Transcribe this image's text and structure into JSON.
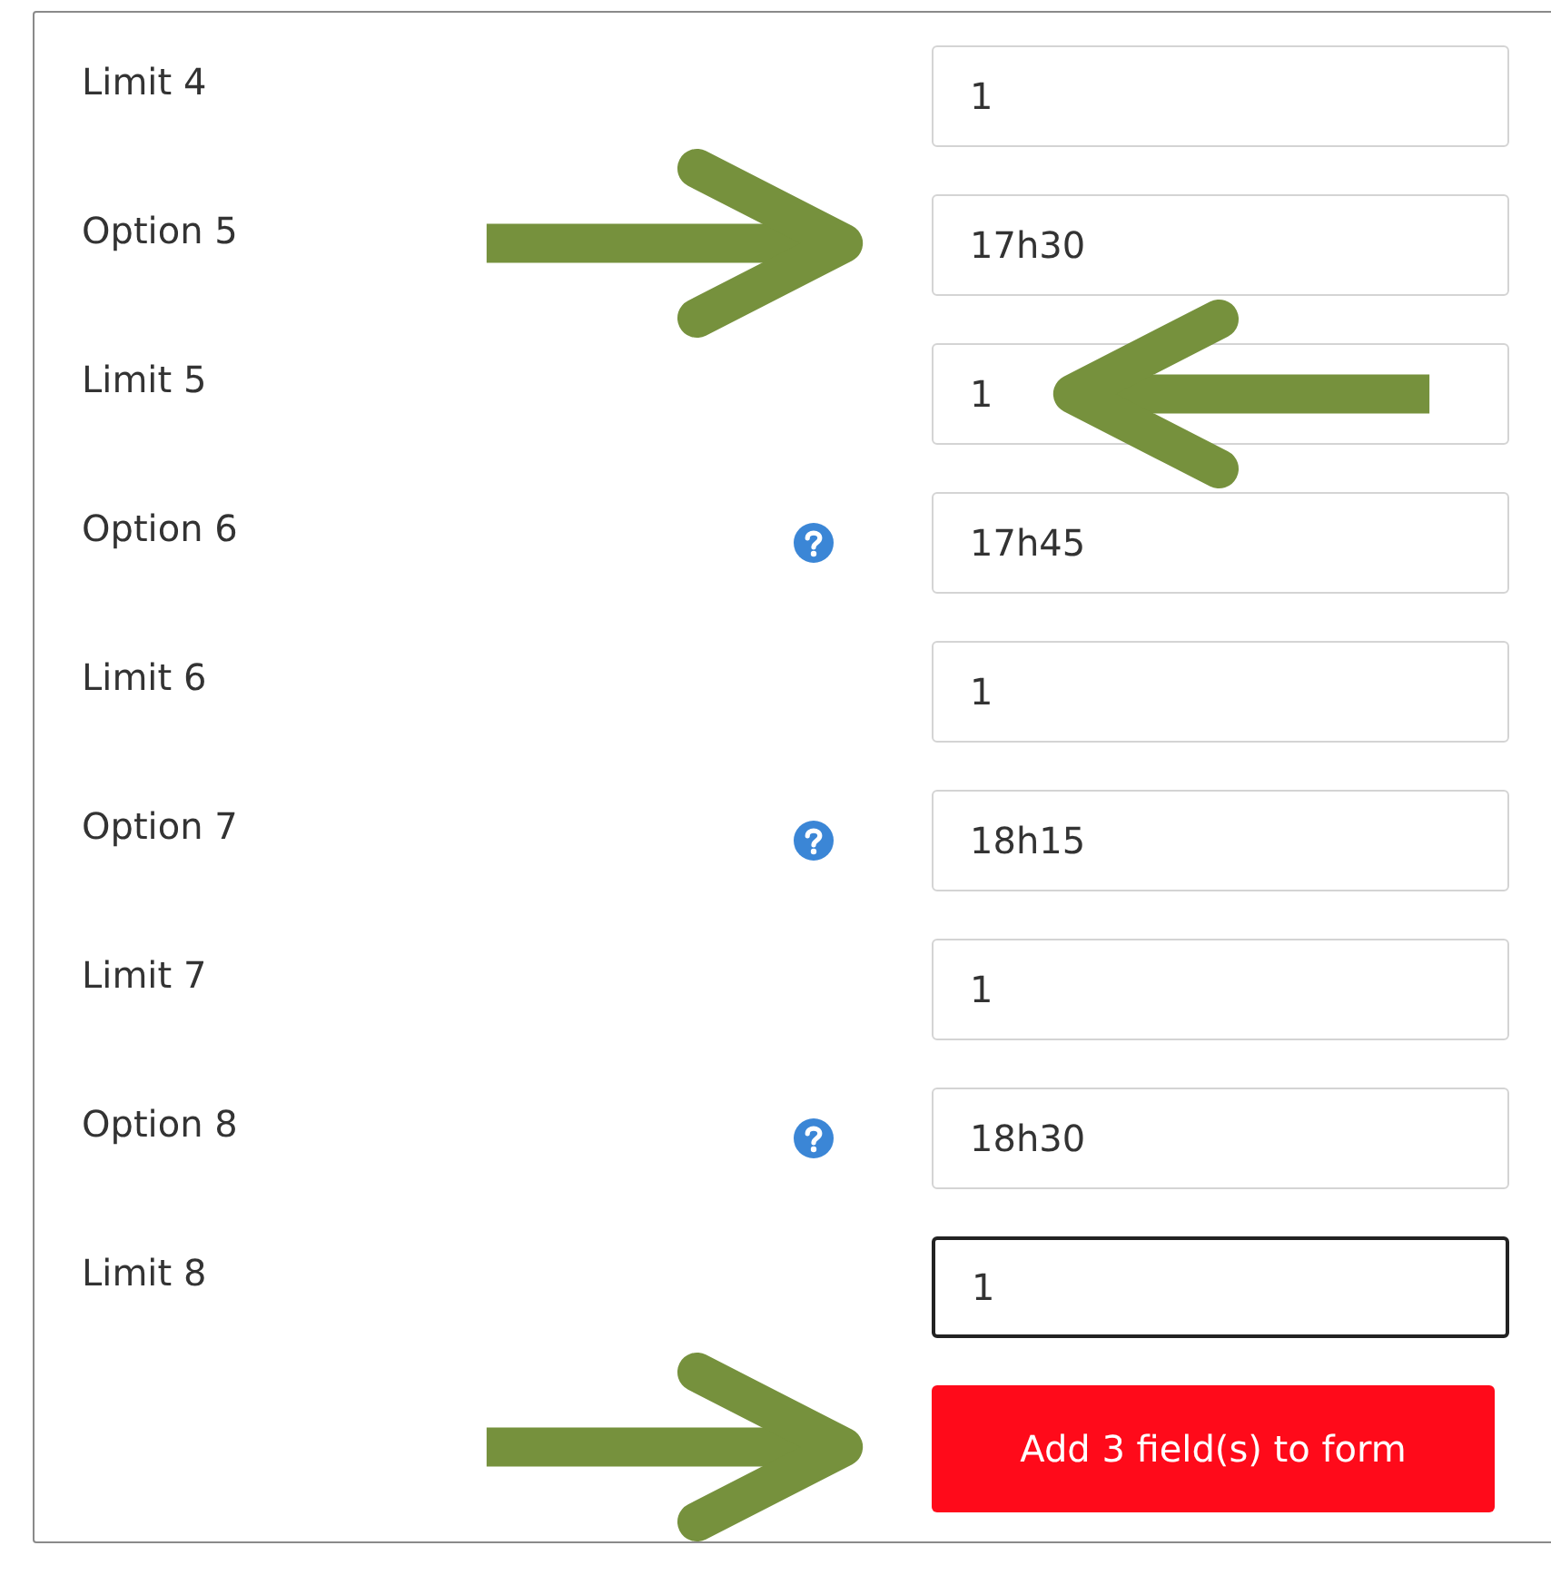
{
  "rows": [
    {
      "label": "Limit 4",
      "value": "1",
      "help": false,
      "focused": false
    },
    {
      "label": "Option 5",
      "value": "17h30",
      "help": false,
      "focused": false,
      "arrow_before": true
    },
    {
      "label": "Limit 5",
      "value": "1",
      "help": false,
      "focused": false,
      "arrow_inside": true
    },
    {
      "label": "Option 6",
      "value": "17h45",
      "help": true,
      "focused": false
    },
    {
      "label": "Limit 6",
      "value": "1",
      "help": false,
      "focused": false
    },
    {
      "label": "Option 7",
      "value": "18h15",
      "help": true,
      "focused": false
    },
    {
      "label": "Limit 7",
      "value": "1",
      "help": false,
      "focused": false
    },
    {
      "label": "Option 8",
      "value": "18h30",
      "help": true,
      "focused": false
    },
    {
      "label": "Limit 8",
      "value": "1",
      "help": false,
      "focused": true
    }
  ],
  "submit": {
    "label": "Add 3 field(s) to form",
    "arrow_before": true
  }
}
